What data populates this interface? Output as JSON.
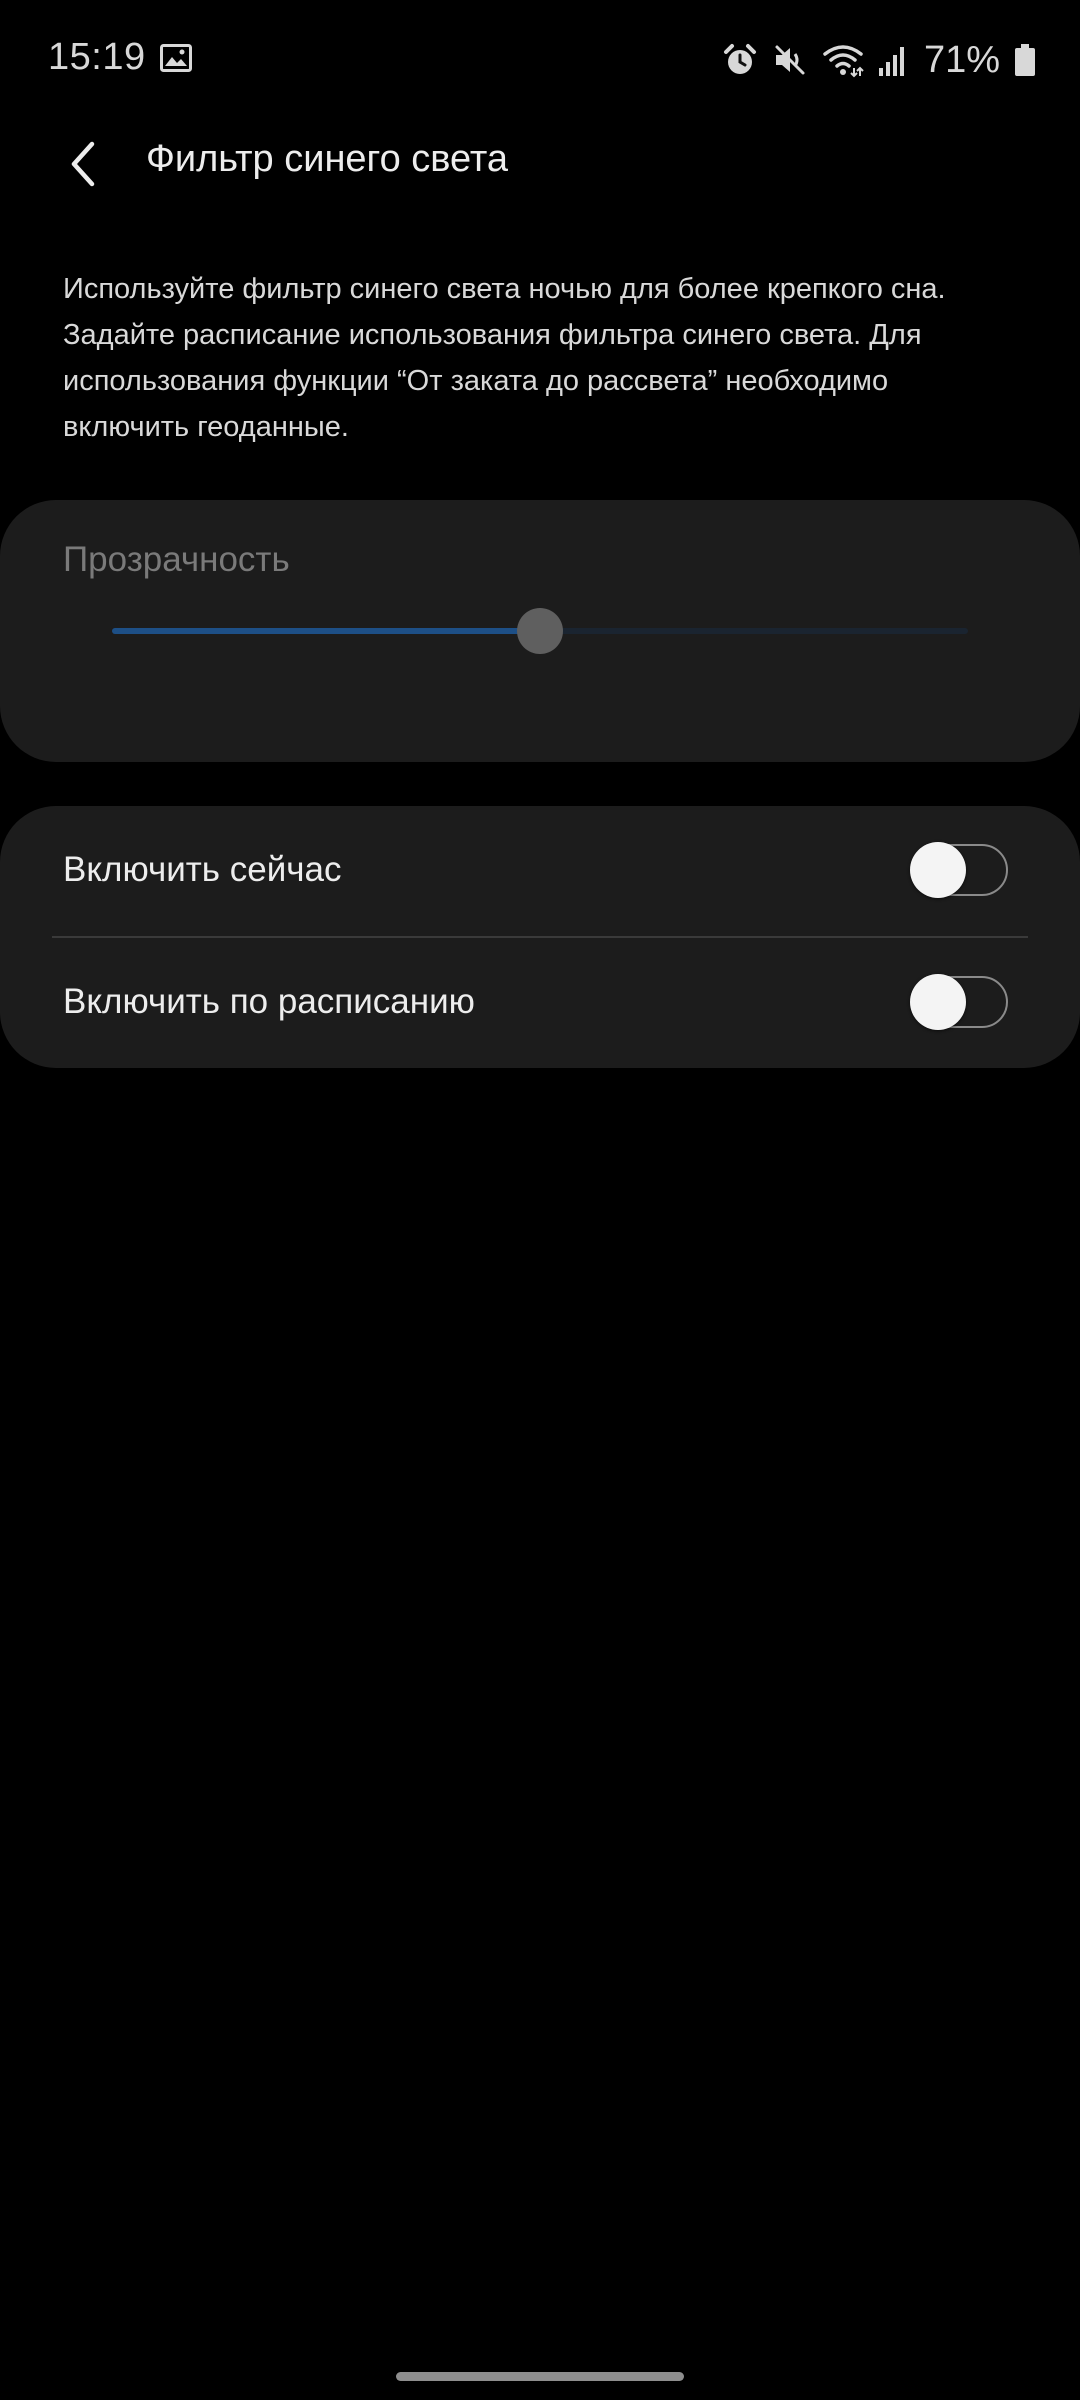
{
  "status_bar": {
    "time": "15:19",
    "battery_text": "71%",
    "icons": [
      "gallery-icon",
      "alarm-icon",
      "mute-icon",
      "wifi-icon",
      "signal-icon",
      "battery-icon"
    ]
  },
  "app_bar": {
    "title": "Фильтр синего света",
    "back_icon": "chevron-left-icon"
  },
  "description": "Используйте фильтр синего света ночью для более крепкого сна. Задайте расписание использования фильтра синего света. Для использования функции “От заката до рассвета” необходимо включить геоданные.",
  "transparency": {
    "label": "Прозрачность",
    "slider_value_percent": 50
  },
  "toggles": [
    {
      "label": "Включить сейчас",
      "on": false
    },
    {
      "label": "Включить по расписанию",
      "on": false
    }
  ],
  "colors": {
    "background": "#000000",
    "card": "#1c1c1c",
    "slider_fill": "#1d4f86",
    "slider_track": "#1a2430",
    "slider_thumb": "#5f5f5f"
  }
}
